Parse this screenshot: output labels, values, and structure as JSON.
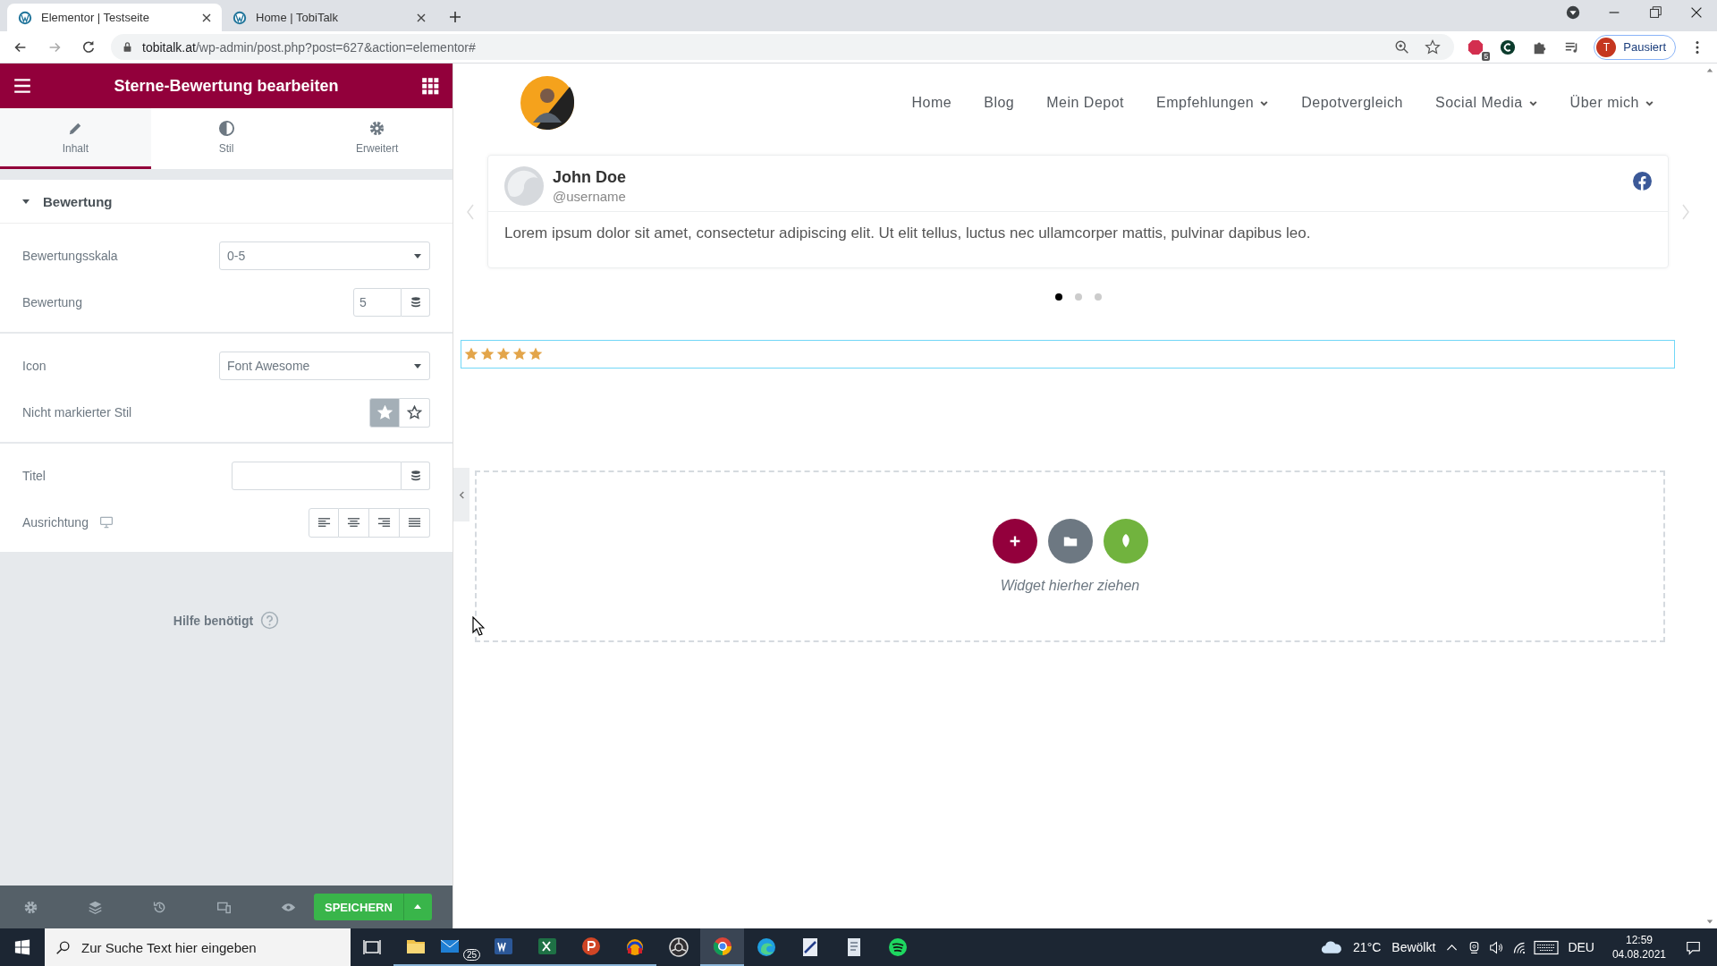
{
  "browser": {
    "tabs": [
      {
        "title": "Elementor | Testseite",
        "selected": true
      },
      {
        "title": "Home | TobiTalk",
        "selected": false
      }
    ],
    "url_host": "tobitalk.at",
    "url_path": "/wp-admin/post.php?post=627&action=elementor#",
    "extension_badge": "5",
    "profile_initial": "T",
    "profile_status": "Pausiert"
  },
  "panel": {
    "title": "Sterne-Bewertung bearbeiten",
    "tabs": [
      {
        "label": "Inhalt",
        "selected": true
      },
      {
        "label": "Stil",
        "selected": false
      },
      {
        "label": "Erweitert",
        "selected": false
      }
    ],
    "section": {
      "title": "Bewertung",
      "expanded": true
    },
    "groups": [
      {
        "controls": [
          {
            "kind": "select",
            "label": "Bewertungsskala",
            "value": "0-5"
          },
          {
            "kind": "number",
            "label": "Bewertung",
            "value": "5"
          }
        ]
      },
      {
        "controls": [
          {
            "kind": "select",
            "label": "Icon",
            "value": "Font Awesome"
          },
          {
            "kind": "choose",
            "label": "Nicht markierter Stil",
            "options": [
              {
                "selected": true
              },
              {
                "selected": false
              }
            ]
          }
        ]
      },
      {
        "controls": [
          {
            "kind": "text",
            "label": "Titel"
          },
          {
            "kind": "align",
            "label": "Ausrichtung",
            "options": [
              {
                "selected": false
              },
              {
                "selected": false
              },
              {
                "selected": false
              },
              {
                "selected": false
              }
            ]
          }
        ]
      }
    ],
    "help": "Hilfe benötigt",
    "save": "SPEICHERN"
  },
  "preview": {
    "nav": [
      {
        "label": "Home",
        "dropdown": false
      },
      {
        "label": "Blog",
        "dropdown": false
      },
      {
        "label": "Mein Depot",
        "dropdown": false
      },
      {
        "label": "Empfehlungen",
        "dropdown": true
      },
      {
        "label": "Depotvergleich",
        "dropdown": false
      },
      {
        "label": "Social Media",
        "dropdown": true
      },
      {
        "label": "Über mich",
        "dropdown": true
      }
    ],
    "testimonial": {
      "name": "John Doe",
      "handle": "@username",
      "text": "Lorem ipsum dolor sit amet, consectetur adipiscing elit. Ut elit tellus, luctus nec ullamcorper mattis, pulvinar dapibus leo."
    },
    "dots": [
      {
        "selected": true
      },
      {
        "selected": false
      },
      {
        "selected": false
      }
    ],
    "rating": {
      "stars": 5
    },
    "dropzone": "Widget hierher ziehen"
  },
  "taskbar": {
    "search_placeholder": "Zur Suche Text hier eingeben",
    "mail_badge": "25",
    "temperature": "21°C",
    "weather": "Bewölkt",
    "language": "DEU",
    "time": "12:59",
    "date": "04.08.2021"
  }
}
